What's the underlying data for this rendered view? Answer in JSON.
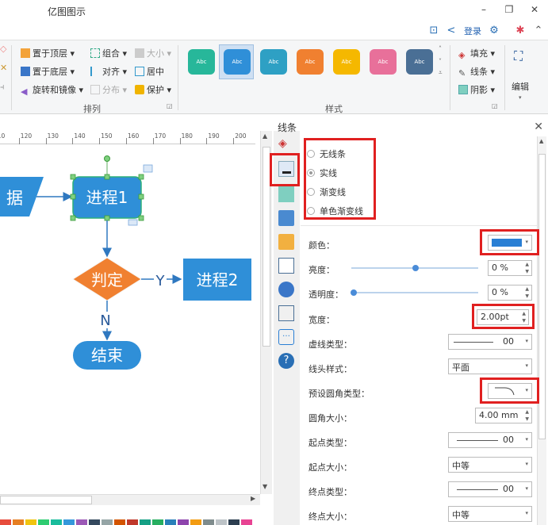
{
  "app": {
    "title": "亿图图示",
    "window_controls": [
      "minimize-icon",
      "restore-icon",
      "close-icon"
    ],
    "login_label": "登录"
  },
  "ribbon": {
    "arrange": {
      "group_label": "排列",
      "items": {
        "bring_front": "置于顶层",
        "group": "组合",
        "size": "大小",
        "send_back": "置于底层",
        "align": "对齐",
        "center": "居中",
        "rotate_mirror": "旋转和镜像",
        "distribute": "分布",
        "protect": "保护"
      }
    },
    "styles": {
      "group_label": "样式",
      "swatch_label": "Abc",
      "swatches": [
        {
          "color": "#27b79a"
        },
        {
          "color": "#2f8fd8",
          "selected": true
        },
        {
          "color": "#2ea0c4"
        },
        {
          "color": "#f08030"
        },
        {
          "color": "#f5b800"
        },
        {
          "color": "#e8709a"
        },
        {
          "color": "#4a6f95"
        }
      ]
    },
    "format": {
      "fill": "填充",
      "line": "线条",
      "shadow": "阴影",
      "edit": "编辑"
    }
  },
  "ruler": {
    "ticks": [
      "110",
      "120",
      "130",
      "140",
      "150",
      "160",
      "170",
      "180",
      "190",
      "200"
    ]
  },
  "diagram": {
    "data_shape": "据",
    "process1": "进程1",
    "decision": "判定",
    "yes": "Y",
    "no": "N",
    "process2": "进程2",
    "end": "结束"
  },
  "panel": {
    "title": "线条",
    "line_types": [
      {
        "label": "无线条",
        "checked": false
      },
      {
        "label": "实线",
        "checked": true
      },
      {
        "label": "渐变线",
        "checked": false
      },
      {
        "label": "单色渐变线",
        "checked": false
      }
    ],
    "props": {
      "color_label": "颜色：",
      "color_value": "#2a7fd4",
      "brightness_label": "亮度：",
      "brightness_value": "0 %",
      "transparency_label": "透明度：",
      "transparency_value": "0 %",
      "width_label": "宽度：",
      "width_value": "2.00pt",
      "dash_label": "虚线类型：",
      "dash_value": "00",
      "arrow_label": "线头样式：",
      "arrow_value": "平面",
      "corner_type_label": "预设圆角类型：",
      "corner_size_label": "圆角大小：",
      "corner_size_value": "4.00 mm",
      "start_type_label": "起点类型：",
      "start_type_value": "00",
      "start_size_label": "起点大小：",
      "start_size_value": "中等",
      "end_type_label": "终点类型：",
      "end_type_value": "00",
      "end_size_label": "终点大小：",
      "end_size_value": "中等"
    }
  },
  "colors": {
    "accent": "#2f8fd8",
    "highlight": "#e02020",
    "process": "#2f8fd8",
    "decision": "#f08030"
  }
}
